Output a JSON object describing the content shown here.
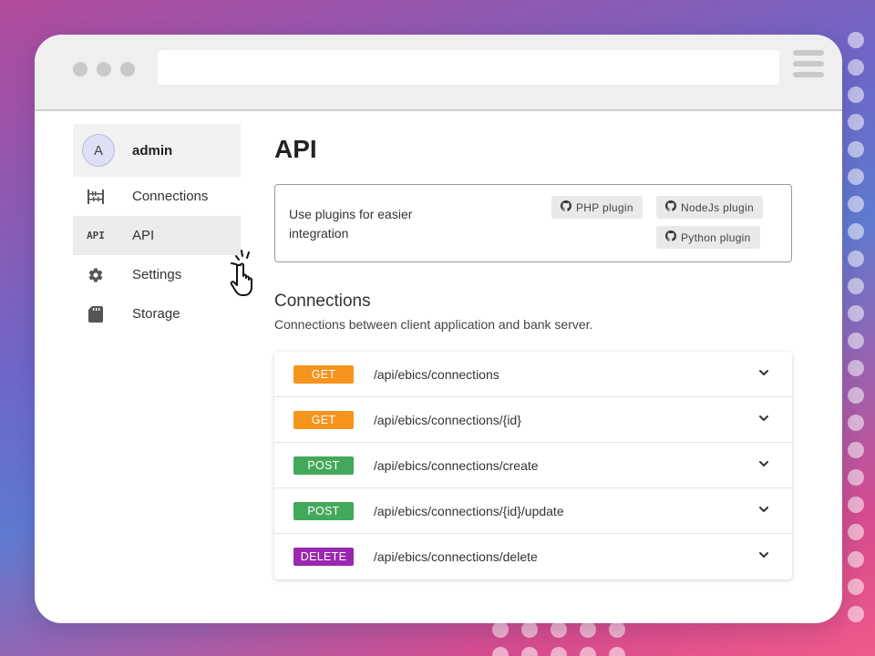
{
  "browser": {
    "url": ""
  },
  "sidebar": {
    "user": {
      "initial": "A",
      "name": "admin"
    },
    "items": [
      {
        "label": "Connections",
        "icon": "connections-icon",
        "active": false
      },
      {
        "label": "API",
        "icon": "api-icon",
        "icon_text": "API",
        "active": true
      },
      {
        "label": "Settings",
        "icon": "gear-icon",
        "active": false
      },
      {
        "label": "Storage",
        "icon": "storage-icon",
        "active": false
      }
    ]
  },
  "main": {
    "title": "API",
    "plugins": {
      "description": "Use plugins for easier integration",
      "buttons": [
        {
          "label": "PHP plugin",
          "icon": "github-icon"
        },
        {
          "label": "NodeJs plugin",
          "icon": "github-icon"
        },
        {
          "label": "Python plugin",
          "icon": "github-icon"
        }
      ]
    },
    "section": {
      "title": "Connections",
      "description": "Connections between client application and bank server."
    },
    "endpoints": [
      {
        "method": "GET",
        "path": "/api/ebics/connections",
        "color": "#f7941d"
      },
      {
        "method": "GET",
        "path": "/api/ebics/connections/{id}",
        "color": "#f7941d"
      },
      {
        "method": "POST",
        "path": "/api/ebics/connections/create",
        "color": "#43a85a"
      },
      {
        "method": "POST",
        "path": "/api/ebics/connections/{id}/update",
        "color": "#43a85a"
      },
      {
        "method": "DELETE",
        "path": "/api/ebics/connections/delete",
        "color": "#9b27b0"
      }
    ]
  }
}
